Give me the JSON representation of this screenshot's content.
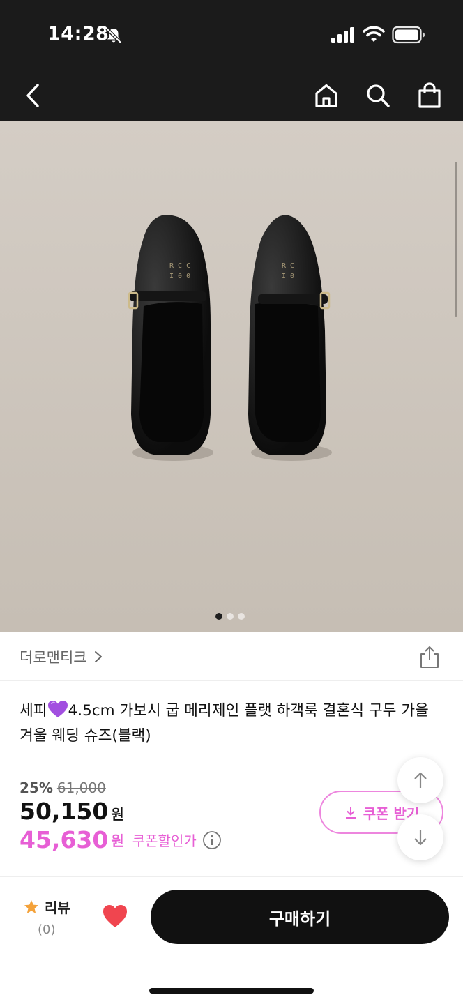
{
  "status_bar": {
    "time": "14:28",
    "icons": [
      "bell-slash-icon",
      "signal-icon",
      "wifi-icon",
      "battery-icon"
    ]
  },
  "nav": {
    "back_icon": "chevron-left-icon",
    "actions": [
      "home-icon",
      "search-icon",
      "shopping-bag-icon"
    ]
  },
  "gallery": {
    "page_count": 3,
    "current_page": 1
  },
  "brand": {
    "name": "더로맨티크"
  },
  "product": {
    "title_prefix": "세피",
    "title_rest": "4.5cm 가보시 굽 메리제인 플랫 하객룩 결혼식 구두 가을 겨울 웨딩 슈즈(블랙)"
  },
  "price": {
    "discount_rate": "25%",
    "original": "61,000",
    "sale": "50,150",
    "won": "원",
    "coupon_price": "45,630",
    "coupon_won": "원",
    "coupon_label": "쿠폰할인가"
  },
  "coupon_button": {
    "label": "쿠폰 받기"
  },
  "bottom": {
    "review_label": "리뷰",
    "review_count": "(0)",
    "buy_label": "구매하기"
  },
  "colors": {
    "accent_pink": "#e75fd5",
    "dark": "#111111",
    "wish_red": "#f0454f"
  }
}
